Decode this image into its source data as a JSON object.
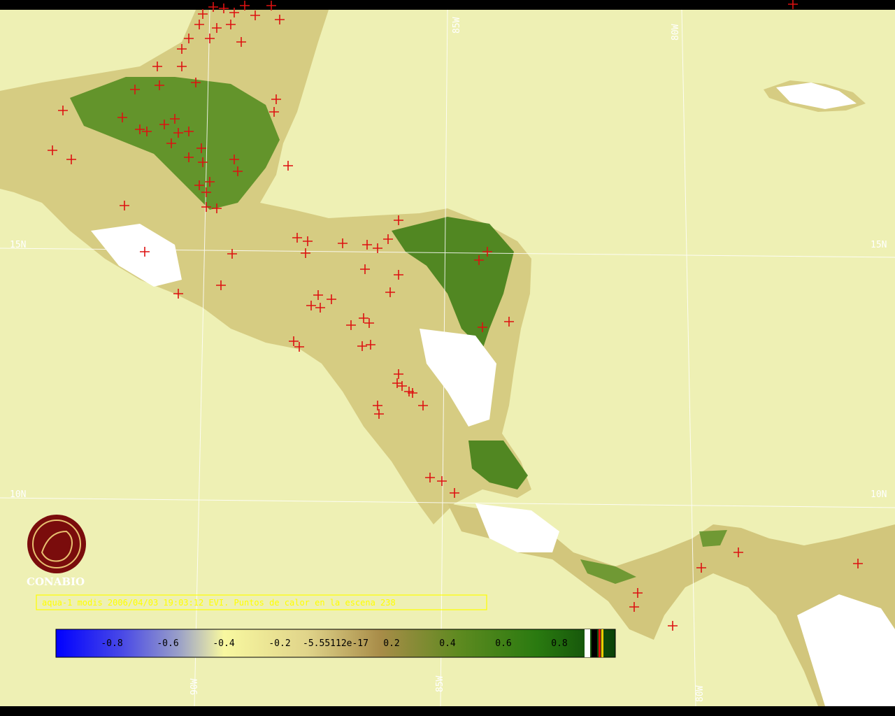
{
  "map": {
    "background": "#eef0b4",
    "border": "#000000",
    "grid_color": "#ffffff",
    "land_colors": {
      "light": "#d9cf86",
      "mid": "#b8b45a",
      "green": "#3f7e14",
      "dark_green": "#2a6a10",
      "cloud": "#ffffff",
      "water_gray": "#9aa0b0"
    },
    "lat_labels": [
      "15N",
      "10N"
    ],
    "lon_labels_top": [
      "85W",
      "80W"
    ],
    "lon_labels_bottom": [
      "90W",
      "85W",
      "80W"
    ]
  },
  "hotspots": {
    "color": "#dd1111",
    "count_label": "Puntos de calor en la escena 238"
  },
  "logo": {
    "name": "CONABIO",
    "color": "#7a0c0c"
  },
  "caption": {
    "text": "aqua-1 modis 2006/04/03 19:03:12 EVI. Puntos de calor en la escena 238",
    "color": "#ffff00"
  },
  "colorbar": {
    "labels": [
      "-0.8",
      "-0.6",
      "-0.4",
      "-0.2",
      "-5.55112e-17",
      "0.2",
      "0.4",
      "0.6",
      "0.8"
    ],
    "stops": [
      "#0000ff",
      "#4a4ae6",
      "#9aa0c8",
      "#f0f0a0",
      "#d8c878",
      "#a8904a",
      "#6a8a20",
      "#2a7a10",
      "#0b4a08"
    ]
  }
}
